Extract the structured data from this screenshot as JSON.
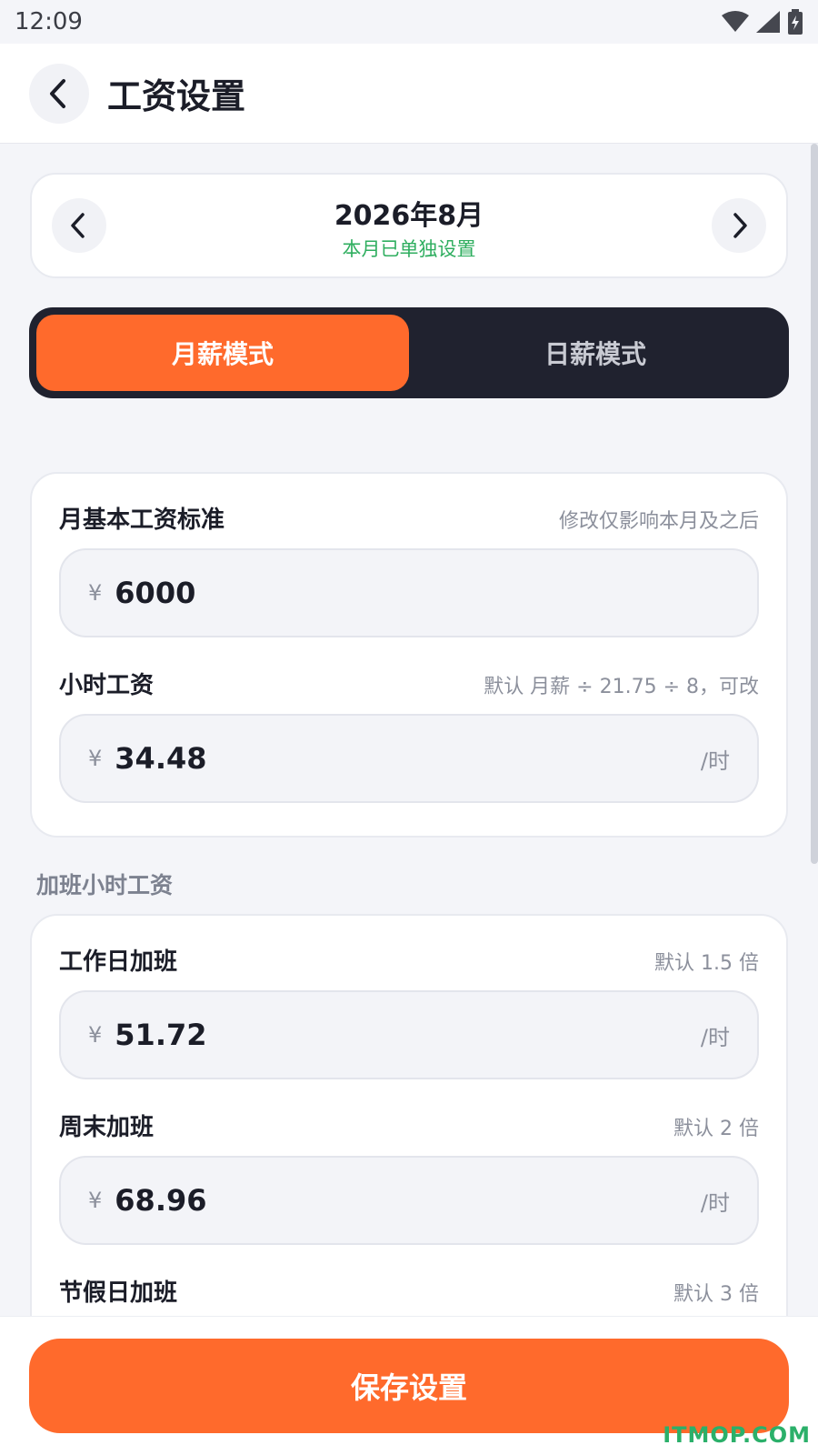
{
  "status": {
    "time": "12:09"
  },
  "header": {
    "title": "工资设置"
  },
  "month": {
    "label": "2026年8月",
    "sub": "本月已单独设置"
  },
  "modes": {
    "monthly": "月薪模式",
    "daily": "日薪模式",
    "active": "monthly"
  },
  "base": {
    "monthly_label": "月基本工资标准",
    "monthly_hint": "修改仅影响本月及之后",
    "monthly_value": "6000",
    "hourly_label": "小时工资",
    "hourly_hint": "默认 月薪 ÷ 21.75 ÷ 8，可改",
    "hourly_value": "34.48",
    "currency": "¥",
    "unit": "/时"
  },
  "overtime": {
    "section_title": "加班小时工资",
    "items": [
      {
        "label": "工作日加班",
        "hint": "默认 1.5 倍",
        "value": "51.72"
      },
      {
        "label": "周末加班",
        "hint": "默认 2 倍",
        "value": "68.96"
      },
      {
        "label": "节假日加班",
        "hint": "默认 3 倍"
      }
    ]
  },
  "footer": {
    "save_label": "保存设置"
  },
  "watermark": "ITMOP.COM",
  "colors": {
    "accent": "#ff6a2c",
    "dark": "#20222f",
    "success": "#2fae5f"
  },
  "icons": [
    "wifi-icon",
    "signal-icon",
    "battery-icon",
    "back-arrow-icon",
    "chevron-left-icon",
    "chevron-right-icon"
  ]
}
